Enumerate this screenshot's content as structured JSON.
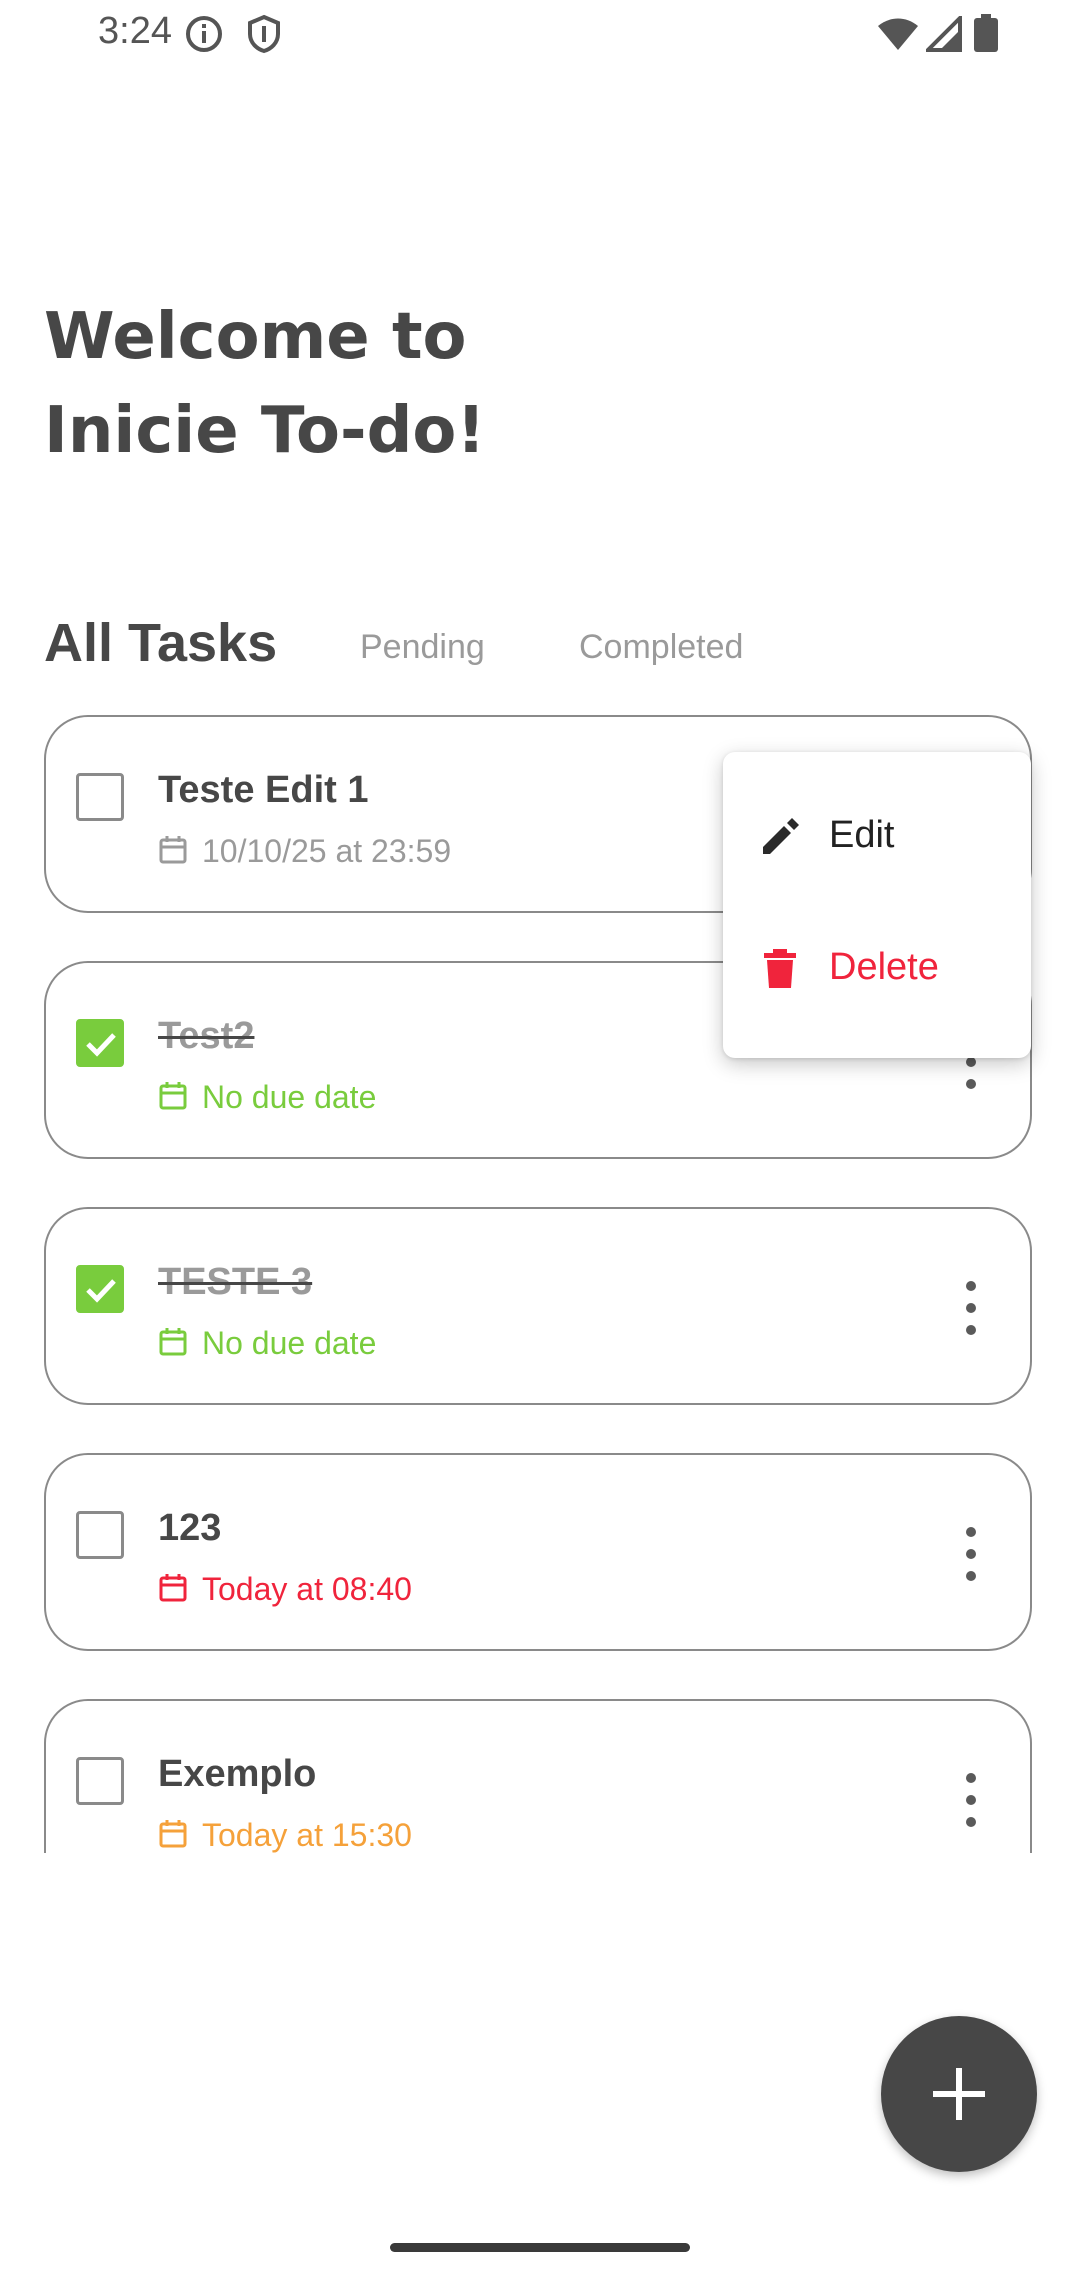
{
  "status_bar": {
    "time": "3:24",
    "icons": [
      "info-icon",
      "shield-icon",
      "wifi-icon",
      "signal-icon",
      "battery-icon"
    ]
  },
  "header": {
    "title_line1": "Welcome to",
    "title_line2": "Inicie To-do!"
  },
  "tabs": {
    "all": "All Tasks",
    "pending": "Pending",
    "completed": "Completed",
    "selected": "all"
  },
  "tasks": [
    {
      "title": "Teste Edit 1",
      "due": "10/10/25 at 23:59",
      "completed": false,
      "due_color": "#9a9a9a"
    },
    {
      "title": "Test2",
      "due": "No due date",
      "completed": true,
      "due_color": "#79cc3d"
    },
    {
      "title": "TESTE 3",
      "due": "No due date",
      "completed": true,
      "due_color": "#79cc3d"
    },
    {
      "title": "123",
      "due": "Today at 08:40",
      "completed": false,
      "due_color": "#f0243c"
    },
    {
      "title": "Exemplo",
      "due": "Today at 15:30",
      "completed": false,
      "due_color": "#f5a13a"
    }
  ],
  "menu": {
    "edit": "Edit",
    "delete": "Delete",
    "edit_color": "#222222",
    "delete_color": "#f0243c"
  },
  "fab": {
    "icon": "plus-icon"
  },
  "colors": {
    "accent_green": "#79cc3d",
    "danger_red": "#f0243c",
    "warning_orange": "#f5a13a",
    "text_dark": "#474747"
  }
}
